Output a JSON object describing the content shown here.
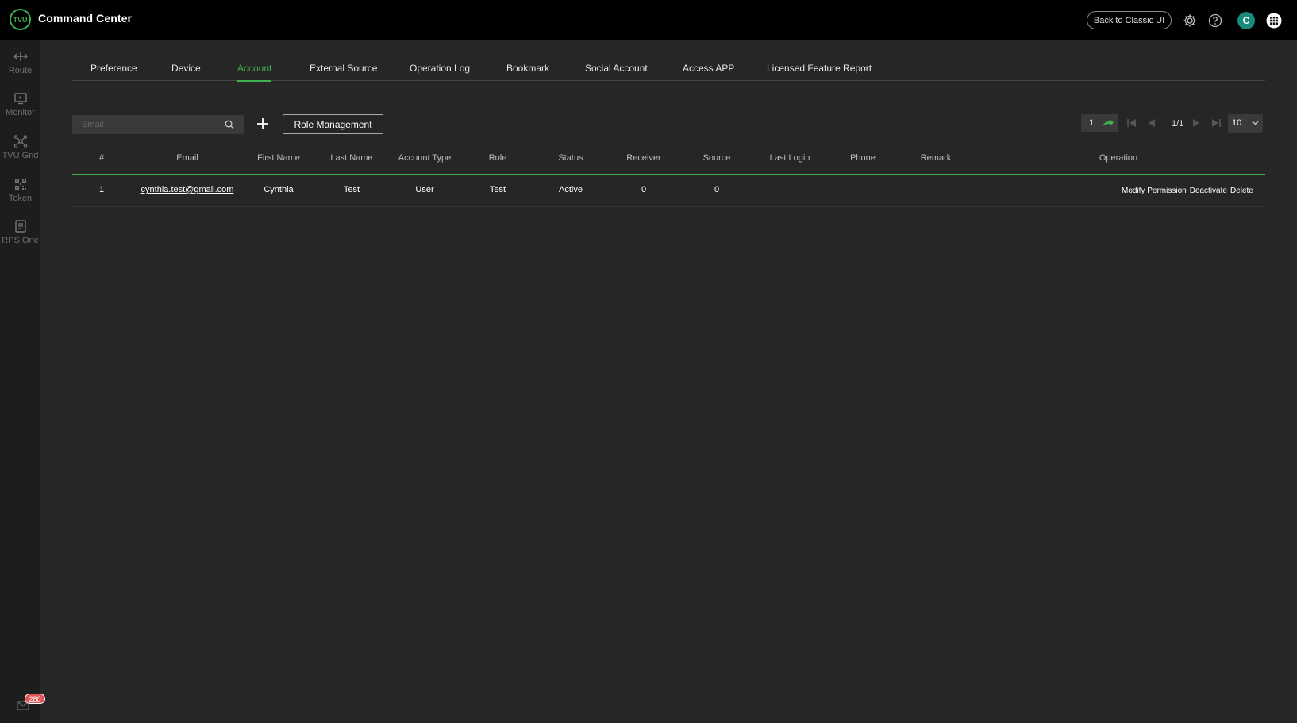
{
  "header": {
    "logo_text": "TVU",
    "title": "Command Center",
    "classic_button": "Back to Classic UI",
    "avatar_initial": "C",
    "accent_color": "#3fb24f"
  },
  "sidebar": {
    "items": [
      {
        "label": "Route",
        "icon": "route-icon"
      },
      {
        "label": "Monitor",
        "icon": "monitor-icon"
      },
      {
        "label": "TVU Grid",
        "icon": "grid-network-icon"
      },
      {
        "label": "Token",
        "icon": "qr-code-icon"
      },
      {
        "label": "RPS One",
        "icon": "rps-one-icon"
      }
    ],
    "mail_badge": "280"
  },
  "tabs": [
    {
      "label": "Preference"
    },
    {
      "label": "Device"
    },
    {
      "label": "Account",
      "active": true
    },
    {
      "label": "External Source"
    },
    {
      "label": "Operation Log"
    },
    {
      "label": "Bookmark"
    },
    {
      "label": "Social Account"
    },
    {
      "label": "Access APP"
    },
    {
      "label": "Licensed Feature Report"
    }
  ],
  "toolbar": {
    "search_placeholder": "Email",
    "role_management_label": "Role Management"
  },
  "pagination": {
    "jump_page": "1",
    "page_info": "1/1",
    "page_size": "10"
  },
  "table": {
    "columns": [
      "#",
      "Email",
      "First Name",
      "Last Name",
      "Account Type",
      "Role",
      "Status",
      "Receiver",
      "Source",
      "Last Login",
      "Phone",
      "Remark",
      "Operation"
    ],
    "rows": [
      {
        "index": "1",
        "email": "cynthia.test@gmail.com",
        "first_name": "Cynthia",
        "last_name": "Test",
        "account_type": "User",
        "role": "Test",
        "status": "Active",
        "receiver": "0",
        "source": "0",
        "last_login": "",
        "phone": "",
        "remark": "",
        "operations": [
          "Modify Permission",
          "Deactivate",
          "Delete"
        ]
      }
    ]
  }
}
